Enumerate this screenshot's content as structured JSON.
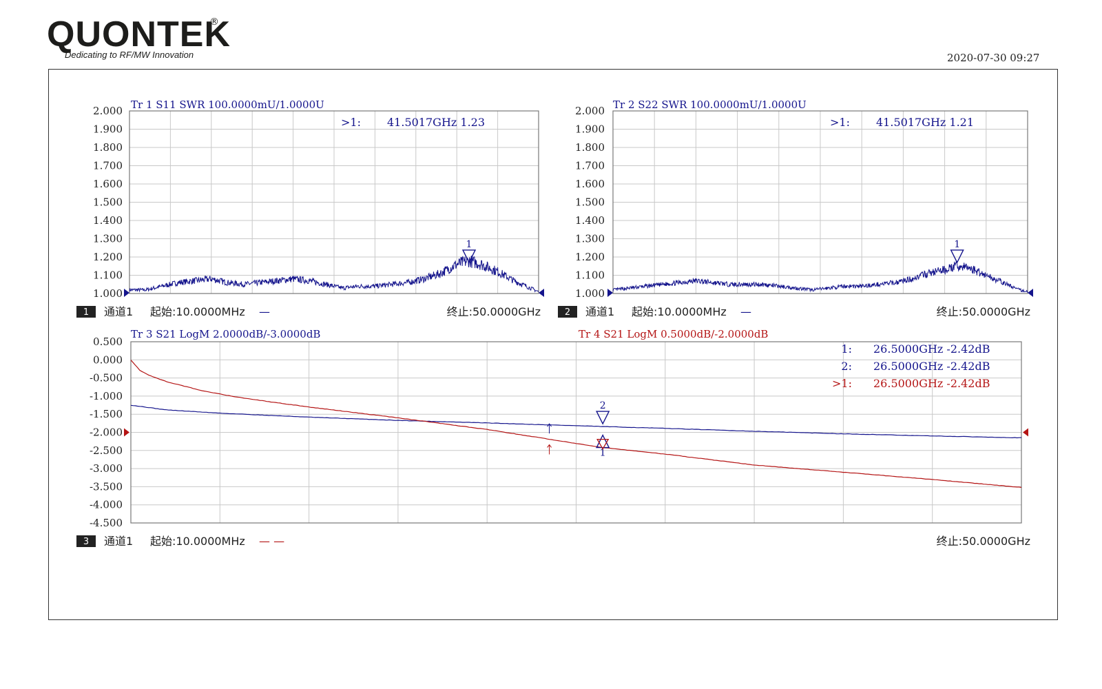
{
  "header": {
    "logo_text": "QUONTEK",
    "logo_registered": "®",
    "logo_tagline": "Dedicating to RF/MW Innovation",
    "timestamp": "2020-07-30 09:27"
  },
  "colors": {
    "blue_trace": "#14148c",
    "red_trace": "#b41414",
    "grid": "#c8c8c8",
    "text": "#222222"
  },
  "chart_data": [
    {
      "type": "line",
      "panel_id": "1",
      "title": "Tr 1  S11 SWR 100.0000mU/1.0000U",
      "series": [
        {
          "name": "S11 SWR",
          "color": "#14148c",
          "x": [
            0.01,
            2,
            4,
            6,
            8,
            10,
            12,
            14,
            16,
            18,
            20,
            22,
            24,
            26,
            28,
            30,
            32,
            34,
            36,
            38,
            40,
            41.5,
            43,
            45,
            47,
            49,
            50
          ],
          "values": [
            1.02,
            1.02,
            1.04,
            1.06,
            1.07,
            1.08,
            1.06,
            1.05,
            1.06,
            1.07,
            1.08,
            1.07,
            1.05,
            1.03,
            1.04,
            1.04,
            1.05,
            1.06,
            1.08,
            1.11,
            1.16,
            1.18,
            1.16,
            1.12,
            1.07,
            1.03,
            1.01
          ],
          "noise": 0.035
        }
      ],
      "ylim": [
        1.0,
        2.0
      ],
      "y_ticks": [
        "2.000",
        "1.900",
        "1.800",
        "1.700",
        "1.600",
        "1.500",
        "1.400",
        "1.300",
        "1.200",
        "1.100",
        "1.000"
      ],
      "xlim": [
        0.01,
        50
      ],
      "marker": {
        "id": "1",
        "x": 41.5017,
        "y": 1.23,
        "readout": [
          ">1:",
          "41.5017GHz 1.23"
        ]
      },
      "channel": {
        "num": "1",
        "label": "通道1",
        "start": "起始:10.0000MHz",
        "legend": "—",
        "stop": "终止:50.0000GHz"
      }
    },
    {
      "type": "line",
      "panel_id": "2",
      "title": "Tr 2  S22 SWR 100.0000mU/1.0000U",
      "series": [
        {
          "name": "S22 SWR",
          "color": "#14148c",
          "x": [
            0.01,
            2,
            4,
            6,
            8,
            10,
            12,
            14,
            16,
            18,
            20,
            22,
            24,
            26,
            28,
            30,
            32,
            34,
            36,
            38,
            40,
            41.5,
            43,
            45,
            47,
            49,
            50
          ],
          "values": [
            1.02,
            1.03,
            1.04,
            1.05,
            1.06,
            1.07,
            1.06,
            1.05,
            1.05,
            1.05,
            1.04,
            1.03,
            1.02,
            1.03,
            1.04,
            1.04,
            1.05,
            1.06,
            1.08,
            1.11,
            1.13,
            1.15,
            1.14,
            1.1,
            1.06,
            1.02,
            1.01
          ],
          "noise": 0.03
        }
      ],
      "ylim": [
        1.0,
        2.0
      ],
      "y_ticks": [
        "2.000",
        "1.900",
        "1.800",
        "1.700",
        "1.600",
        "1.500",
        "1.400",
        "1.300",
        "1.200",
        "1.100",
        "1.000"
      ],
      "xlim": [
        0.01,
        50
      ],
      "marker": {
        "id": "1",
        "x": 41.5017,
        "y": 1.21,
        "readout": [
          ">1:",
          "41.5017GHz 1.21"
        ]
      },
      "channel": {
        "num": "2",
        "label": "通道1",
        "start": "起始:10.0000MHz",
        "legend": "—",
        "stop": "终止:50.0000GHz"
      }
    },
    {
      "type": "line",
      "panel_id": "3",
      "titles": [
        {
          "text": "Tr 3  S21 LogM 2.0000dB/-3.0000dB",
          "color": "#14148c"
        },
        {
          "text": "Tr 4  S21 LogM 0.5000dB/-2.0000dB",
          "color": "#b41414"
        }
      ],
      "series": [
        {
          "name": "S21 Tr 3",
          "color": "#14148c",
          "x": [
            0.01,
            2,
            5,
            10,
            15,
            20,
            26.5,
            30,
            35,
            40,
            45,
            50
          ],
          "values": [
            -1.25,
            -1.38,
            -1.47,
            -1.58,
            -1.67,
            -1.74,
            -1.84,
            -1.89,
            -1.97,
            -2.04,
            -2.1,
            -2.15
          ]
        },
        {
          "name": "S21 Tr 4",
          "color": "#b41414",
          "x": [
            0.01,
            0.5,
            1,
            2,
            4,
            6,
            8,
            10,
            15,
            20,
            26.5,
            30,
            35,
            40,
            45,
            50
          ],
          "values": [
            0.0,
            -0.28,
            -0.42,
            -0.6,
            -0.85,
            -1.03,
            -1.17,
            -1.3,
            -1.6,
            -1.92,
            -2.42,
            -2.6,
            -2.9,
            -3.1,
            -3.3,
            -3.52
          ]
        }
      ],
      "ylim": [
        -4.5,
        0.5
      ],
      "y_ticks": [
        "0.500",
        "0.000",
        "-0.500",
        "-1.000",
        "-1.500",
        "-2.000",
        "-2.500",
        "-3.000",
        "-3.500",
        "-4.000",
        "-4.500"
      ],
      "xlim": [
        0.01,
        50
      ],
      "markers": [
        {
          "id": "1",
          "x": 26.5,
          "y": -2.42,
          "color": "#14148c"
        },
        {
          "id": "2",
          "x": 26.5,
          "y": -2.42,
          "color": "#14148c"
        }
      ],
      "readouts": [
        {
          "label": "1:",
          "value": "26.5000GHz -2.42dB",
          "color": "#14148c"
        },
        {
          "label": "2:",
          "value": "26.5000GHz -2.42dB",
          "color": "#14148c"
        },
        {
          "label": ">1:",
          "value": "26.5000GHz -2.42dB",
          "color": "#b41414"
        }
      ],
      "channel": {
        "num": "3",
        "label": "通道1",
        "start": "起始:10.0000MHz",
        "legend": "— —",
        "stop": "终止:50.0000GHz"
      }
    }
  ]
}
